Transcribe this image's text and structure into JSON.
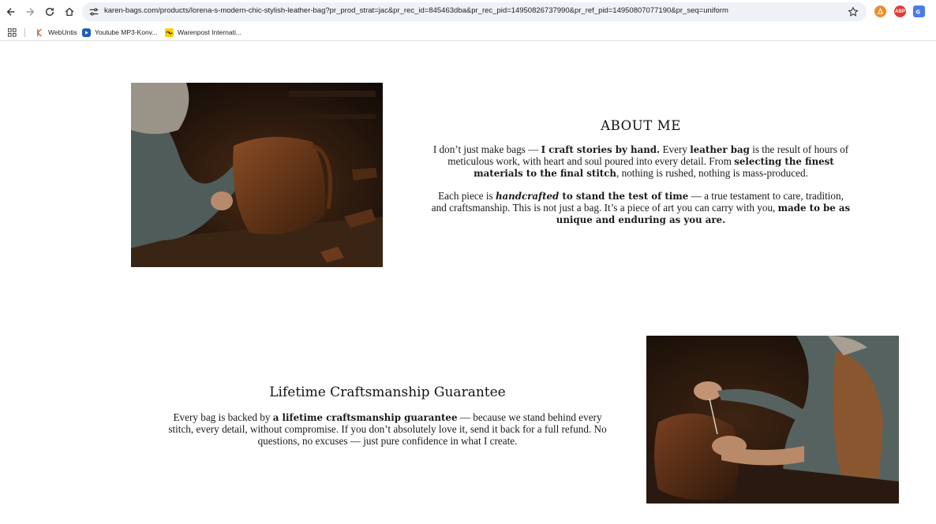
{
  "browser": {
    "url": "karen-bags.com/products/lorena-s-modern-chic-stylish-leather-bag?pr_prod_strat=jac&pr_rec_id=845463dba&pr_rec_pid=14950826737990&pr_ref_pid=14950807077190&pr_seq=uniform",
    "extensions": [
      {
        "name": "extension-a",
        "label": "",
        "color": "#f08c2b"
      },
      {
        "name": "adblock-plus",
        "label": "ABP",
        "color": "#e33a3a"
      },
      {
        "name": "translate",
        "label": "",
        "color": "#4a7ce6"
      }
    ],
    "bookmarks": [
      {
        "label": "WebUntis"
      },
      {
        "label": "Youtube MP3-Konv..."
      },
      {
        "label": "Warenpost Internati..."
      }
    ]
  },
  "about": {
    "title": "ABOUT ME",
    "p1": [
      {
        "t": "I don’t just make bags — "
      },
      {
        "t": "I craft stories by hand.",
        "b": true
      },
      {
        "t": " Every "
      },
      {
        "t": "leather bag",
        "b": true
      },
      {
        "t": " is the result of hours of meticulous work, with heart and soul poured into every detail. From "
      },
      {
        "t": "selecting the finest materials to the final stitch",
        "b": true
      },
      {
        "t": ", nothing is rushed, nothing is mass-produced."
      }
    ],
    "p2": [
      {
        "t": "Each piece is "
      },
      {
        "t": "handcrafted",
        "b": true,
        "i": true
      },
      {
        "t": " to stand the test of time",
        "b": true
      },
      {
        "t": " — a true testament to care, tradition, and craftsmanship. This is not just a bag. It’s a piece of art you can carry with you, "
      },
      {
        "t": "made to be as unique and enduring as you are.",
        "b": true
      }
    ]
  },
  "guarantee": {
    "title": "Lifetime Craftsmanship Guarantee",
    "p1": [
      {
        "t": "Every bag is backed by "
      },
      {
        "t": "a lifetime craftsmanship guarantee",
        "b": true
      },
      {
        "t": " — because we stand behind every stitch, every detail, without compromise. If you don’t absolutely love it, send it back for a full refund. No questions, no excuses — just pure confidence in what I create."
      }
    ]
  },
  "colors": {
    "accent_leather": "#6b3a1c",
    "workshop_dark": "#2a1a10"
  }
}
